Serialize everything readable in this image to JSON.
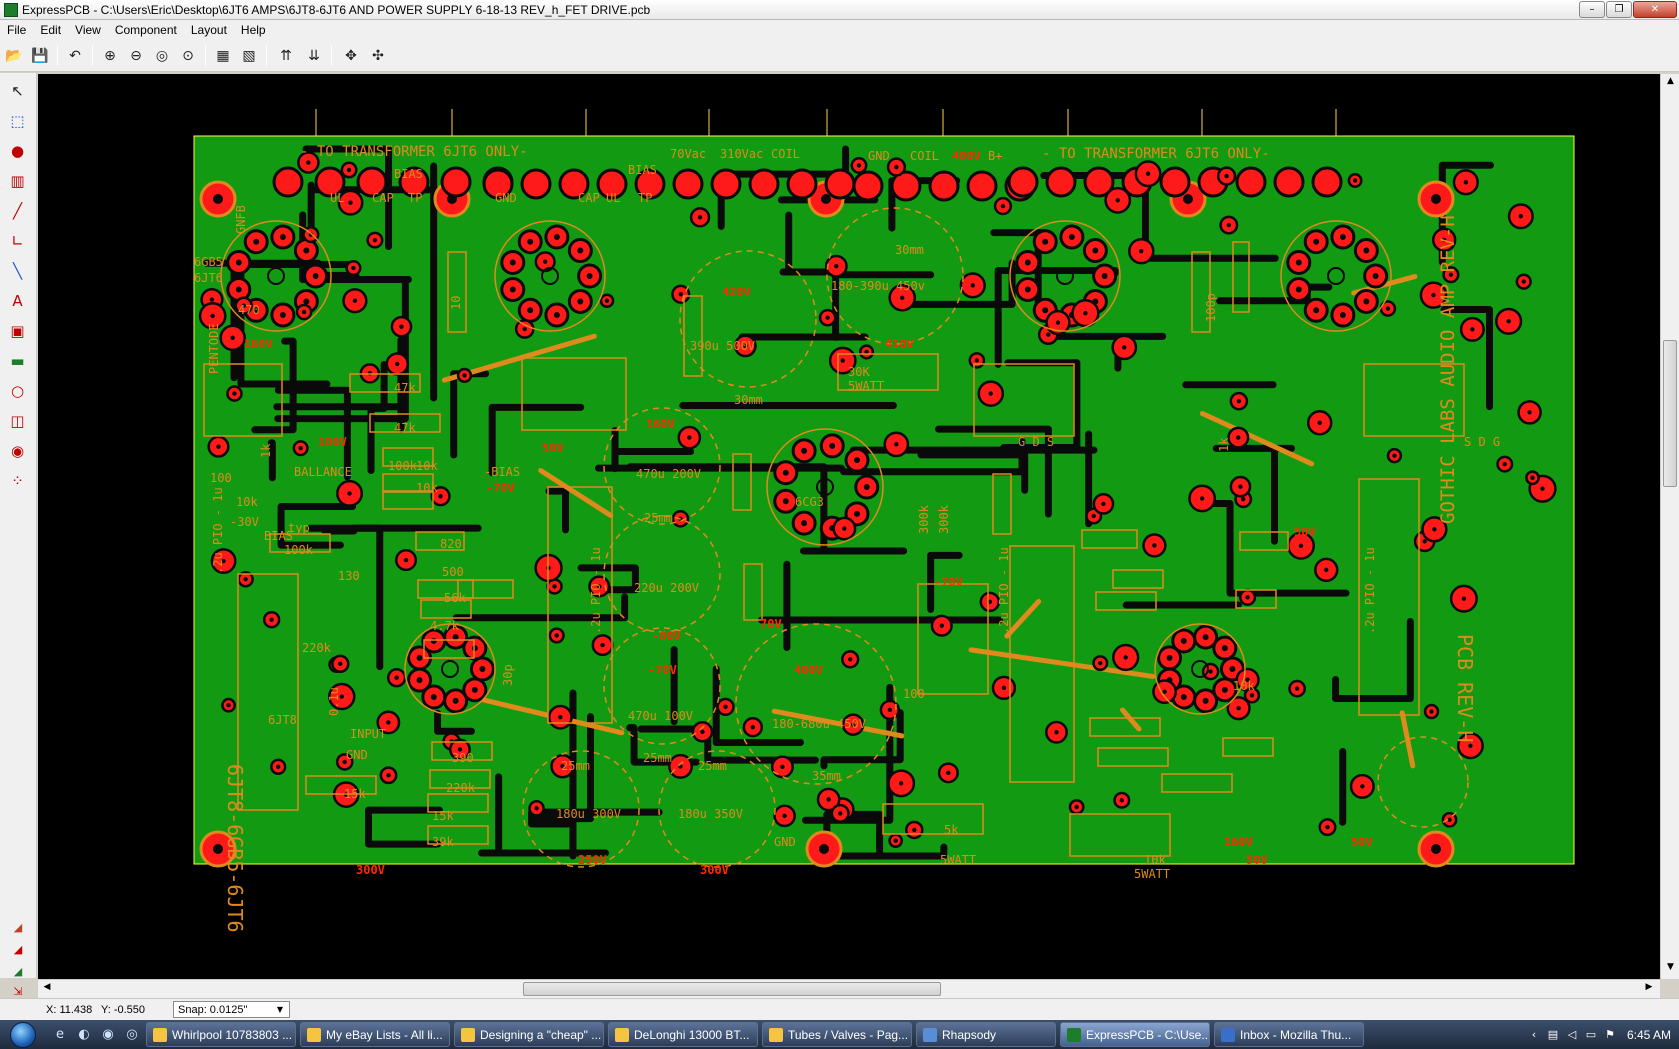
{
  "window": {
    "title": "ExpressPCB - C:\\Users\\Eric\\Desktop\\6JT6 AMPS\\6JT8-6JT6 AND POWER SUPPLY 6-18-13 REV_h_FET DRIVE.pcb",
    "min_glyph": "–",
    "max_glyph": "❐",
    "close_glyph": "✕"
  },
  "menu": [
    "File",
    "Edit",
    "View",
    "Component",
    "Layout",
    "Help"
  ],
  "toolbar": {
    "open_glyph": "📂",
    "save_glyph": "💾",
    "undo_glyph": "↶",
    "zoom_in_glyph": "⊕",
    "zoom_out_glyph": "⊖",
    "zoom_fit_glyph": "◎",
    "zoom_prev_glyph": "⊙",
    "props_glyph": "▦",
    "props2_glyph": "▧",
    "top_layer_glyph": "⇈",
    "bottom_layer_glyph": "⇊",
    "move_glyph": "✥",
    "rotate_glyph": "✣"
  },
  "left_tools": [
    "↖",
    "⬚",
    "●",
    "▥",
    "╱",
    "∟",
    "╲",
    "A",
    "▣",
    "▬",
    "○",
    "◫",
    "◉",
    "⁘"
  ],
  "layer_tools": [
    "◢",
    "◢",
    "◢",
    "⇲"
  ],
  "board": {
    "silk_texts": [
      "- TO TRANSFORMER 6JT6 ONLY-",
      "- TO TRANSFORMER 6JT6 ONLY-",
      "70Vac",
      "310Vac",
      "COIL",
      "GND",
      "COIL",
      "400V",
      "B+",
      "UL",
      "CAP",
      "BIAS",
      "TP",
      "GND",
      "GNFB",
      "CAP",
      "UL",
      "BIAS",
      "TP",
      "6GB5",
      "6JT6",
      "PENTODE",
      "470",
      "160V",
      "47k",
      "47k",
      "1k",
      "100k",
      "10k",
      "10k",
      "10k",
      "100",
      "BALLANCE",
      "-BIAS",
      "-70V",
      "-30V",
      "typ",
      "BIAS",
      "100k",
      "130",
      "820",
      "500",
      "56k",
      "4.7k",
      "220k",
      "INPUT",
      "GND",
      "15k",
      "220k",
      "390",
      "15k",
      "39k",
      "300V",
      "420V",
      "390u 500V",
      "30mm",
      "160V",
      "470u 200V",
      "25mm",
      "220u 200V",
      "-80V",
      "-70V",
      "470u 100V",
      "25mm",
      "180u 300V",
      "25mm",
      "250V",
      "180u 350V",
      "25mm",
      "300V",
      "GND",
      "30K",
      "5WATT",
      "410V",
      "30mm",
      "180-390u 450v",
      "6CG3",
      "-70V",
      "70V",
      "400V",
      "180-680u 450V",
      "35mm",
      "5k",
      "5WATT",
      "10k",
      "5WATT",
      "300k",
      "300k",
      "100",
      "10k",
      "6JT8",
      ".2u PIO - 1u",
      ".2u PIO - 1u",
      ".2u PIO - 1u",
      ".2u PIO - 1u",
      "6JT8-6GB5-6JT6",
      "PCB REV-H",
      "GOTHIC LABS AUDIO AMP REV-H",
      "50V",
      "160V",
      "50V",
      "50V",
      "100V",
      "50V",
      "G D S",
      "S D G",
      "1k",
      "10",
      "100p",
      "30p",
      "0.1u"
    ]
  },
  "status": {
    "x": "X: 11.438",
    "y": "Y: -0.550",
    "snap": "Snap: 0.0125\""
  },
  "taskbar": {
    "items": [
      {
        "label": "Whirlpool 10783803 ...",
        "color": "#f5c542"
      },
      {
        "label": "My eBay Lists - All li...",
        "color": "#f5c542"
      },
      {
        "label": "Designing a \"cheap\" ...",
        "color": "#f5c542"
      },
      {
        "label": "DeLonghi 13000 BT...",
        "color": "#f5c542"
      },
      {
        "label": "Tubes / Valves - Pag...",
        "color": "#f5c542"
      },
      {
        "label": "Rhapsody",
        "color": "#5a8dd8"
      },
      {
        "label": "ExpressPCB - C:\\Use...",
        "color": "#1d7d2d"
      },
      {
        "label": "Inbox - Mozilla Thu...",
        "color": "#3a6fc9"
      }
    ],
    "clock": "6:45 AM"
  }
}
